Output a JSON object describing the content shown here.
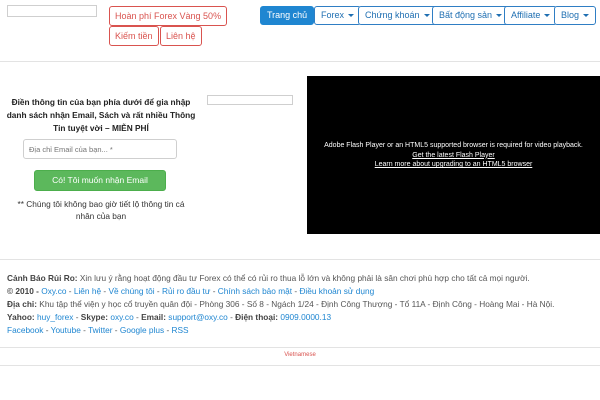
{
  "header": {
    "promo_buttons": [
      "Hoàn phí Forex Vàng 50%",
      "Kiếm tiền",
      "Liên hệ"
    ],
    "nav": [
      {
        "label": "Trang chủ",
        "dropdown": false,
        "active": true
      },
      {
        "label": "Forex",
        "dropdown": true
      },
      {
        "label": "Chứng khoán",
        "dropdown": true
      },
      {
        "label": "Bất động sản",
        "dropdown": true
      },
      {
        "label": "Affiliate",
        "dropdown": true
      },
      {
        "label": "Blog",
        "dropdown": true
      }
    ]
  },
  "signup": {
    "heading": "Điền thông tin của bạn phía dưới để gia nhập danh sách nhận Email, Sách và rất nhiều Thông Tin tuyệt vời – MIỄN PHÍ",
    "email_placeholder": "Địa chỉ Email của bạn... *",
    "submit_label": "Có! Tôi muốn nhận Email",
    "privacy_note": "** Chúng tôi không bao giờ tiết lộ thông tin cá nhân của bạn"
  },
  "video": {
    "message": "Adobe Flash Player or an HTML5 supported browser is required for video playback.",
    "link1": "Get the latest Flash Player",
    "link2": "Learn more about upgrading to an HTML5 browser"
  },
  "footer": {
    "warning_label": "Cảnh Báo Rủi Ro:",
    "warning_text": "Xin lưu ý rằng hoạt động đầu tư Forex có thể có rủi ro thua lỗ lớn và không phải là sân chơi phù hợp cho tất cả mọi người.",
    "copyright": "© 2010 -",
    "links": [
      "Oxy.co",
      "Liên hệ",
      "Về chúng tôi",
      "Rủi ro đầu tư",
      "Chính sách bảo mật",
      "Điều khoản sử dụng"
    ],
    "address_label": "Địa chỉ:",
    "address": "Khu tập thể viện y học cổ truyền quân đội - Phòng 306 - Số 8 - Ngách 1/24 - Định Công Thượng - Tổ 11A - Định Công - Hoàng Mai - Hà Nội.",
    "yahoo_label": "Yahoo:",
    "yahoo": "huy_forex",
    "skype_label": "Skype:",
    "skype": "oxy.co",
    "email_label": "Email:",
    "email": "support@oxy.co",
    "phone_label": "Điện thoại:",
    "phone": "0909.0000.13",
    "social": [
      "Facebook",
      "Youtube",
      "Twitter",
      "Google plus",
      "RSS"
    ],
    "language": "Vietnamese"
  },
  "colors": {
    "accent": "#1f86d1",
    "promo_red": "#d9534f",
    "cta_green": "#5cb85c",
    "video_bg": "#000000"
  }
}
